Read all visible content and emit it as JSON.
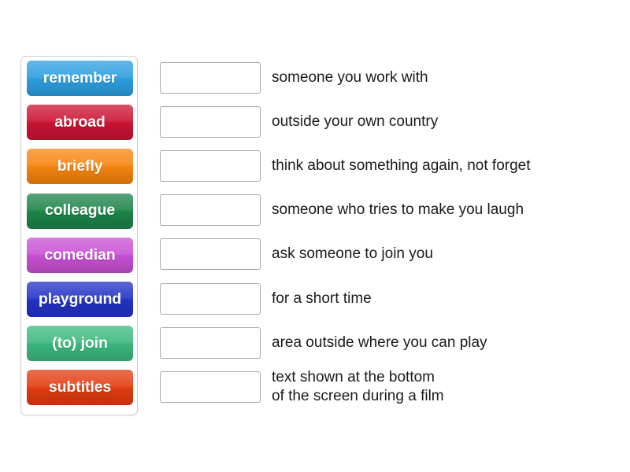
{
  "activity": {
    "type": "match-up",
    "background_color": "#ffffff"
  },
  "tiles_panel": {
    "name": "word-tiles-panel",
    "border_color": "#d0d0d0",
    "tiles": [
      {
        "label": "remember",
        "color": "#2d9fe0",
        "text_color": "#ffffff"
      },
      {
        "label": "abroad",
        "color": "#cc1333",
        "text_color": "#ffffff"
      },
      {
        "label": "briefly",
        "color": "#f7850f",
        "text_color": "#ffffff"
      },
      {
        "label": "colleague",
        "color": "#1e8449",
        "text_color": "#ffffff"
      },
      {
        "label": "comedian",
        "color": "#c850d4",
        "text_color": "#ffffff"
      },
      {
        "label": "playground",
        "color": "#2232c6",
        "text_color": "#ffffff"
      },
      {
        "label": "(to) join",
        "color": "#3cb97e",
        "text_color": "#ffffff"
      },
      {
        "label": "subtitles",
        "color": "#e43c10",
        "text_color": "#ffffff"
      }
    ]
  },
  "rows": [
    {
      "answer_value": "",
      "definition": "someone you work with"
    },
    {
      "answer_value": "",
      "definition": "outside your own country"
    },
    {
      "answer_value": "",
      "definition": "think about something again, not forget"
    },
    {
      "answer_value": "",
      "definition": "someone who tries to make you laugh"
    },
    {
      "answer_value": "",
      "definition": "ask someone to join you"
    },
    {
      "answer_value": "",
      "definition": "for a short time"
    },
    {
      "answer_value": "",
      "definition": "area outside where you can play"
    },
    {
      "answer_value": "",
      "definition": "text shown at the bottom\nof the screen during a film"
    }
  ]
}
